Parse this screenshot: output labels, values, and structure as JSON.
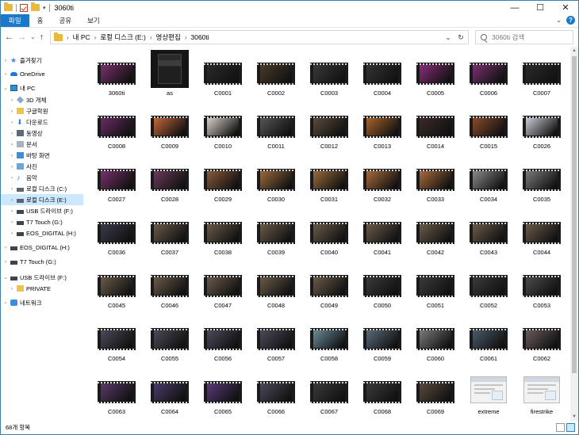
{
  "window": {
    "title": "3060ti",
    "controls": {
      "minimize": "—",
      "maximize": "☐",
      "close": "✕"
    }
  },
  "ribbon": {
    "tabs": [
      "파일",
      "홈",
      "공유",
      "보기"
    ],
    "help": "?"
  },
  "address": {
    "crumbs": [
      "내 PC",
      "로컬 디스크 (E:)",
      "영상편집",
      "3060ti"
    ],
    "search_placeholder": "3060ti 검색"
  },
  "nav": [
    {
      "label": "즐겨찾기",
      "icon": "quick-access-star-icon",
      "level": 0,
      "arrow": "›",
      "selected": false
    },
    {
      "label": "OneDrive",
      "icon": "onedrive-cloud-icon",
      "level": 0,
      "arrow": "›",
      "selected": false
    },
    {
      "label": "내 PC",
      "icon": "this-pc-icon",
      "level": 0,
      "arrow": "⌄",
      "selected": false
    },
    {
      "label": "3D 개체",
      "icon": "3d-objects-icon",
      "level": 1,
      "arrow": "›",
      "selected": false
    },
    {
      "label": "구글학원",
      "icon": "folder-icon",
      "level": 1,
      "arrow": "›",
      "selected": false
    },
    {
      "label": "다운로드",
      "icon": "downloads-icon",
      "level": 1,
      "arrow": "›",
      "selected": false
    },
    {
      "label": "동영상",
      "icon": "videos-icon",
      "level": 1,
      "arrow": "›",
      "selected": false
    },
    {
      "label": "문서",
      "icon": "documents-icon",
      "level": 1,
      "arrow": "›",
      "selected": false
    },
    {
      "label": "바탕 화면",
      "icon": "desktop-icon",
      "level": 1,
      "arrow": "›",
      "selected": false
    },
    {
      "label": "사진",
      "icon": "pictures-icon",
      "level": 1,
      "arrow": "›",
      "selected": false
    },
    {
      "label": "음악",
      "icon": "music-icon",
      "level": 1,
      "arrow": "›",
      "selected": false
    },
    {
      "label": "로컬 디스크 (C:)",
      "icon": "drive-icon",
      "level": 1,
      "arrow": "›",
      "selected": false
    },
    {
      "label": "로컬 디스크 (E:)",
      "icon": "drive-icon",
      "level": 1,
      "arrow": "›",
      "selected": true
    },
    {
      "label": "USB 드라이브 (F:)",
      "icon": "usb-drive-icon",
      "level": 1,
      "arrow": "›",
      "selected": false
    },
    {
      "label": "T7 Touch (G:)",
      "icon": "usb-drive-icon",
      "level": 1,
      "arrow": "›",
      "selected": false
    },
    {
      "label": "EOS_DIGITAL (H:)",
      "icon": "usb-drive-icon",
      "level": 1,
      "arrow": "›",
      "selected": false
    },
    {
      "label": "EOS_DIGITAL (H:)",
      "icon": "usb-drive-icon",
      "level": 0,
      "arrow": "›",
      "selected": false
    },
    {
      "label": "T7 Touch (G:)",
      "icon": "usb-drive-icon",
      "level": 0,
      "arrow": "›",
      "selected": false
    },
    {
      "label": "USB 드라이브 (F:)",
      "icon": "usb-drive-icon",
      "level": 0,
      "arrow": "⌄",
      "selected": false
    },
    {
      "label": "PRIVATE",
      "icon": "folder-icon",
      "level": 1,
      "arrow": "›",
      "selected": false
    },
    {
      "label": "네트워크",
      "icon": "network-icon",
      "level": 0,
      "arrow": "›",
      "selected": false
    }
  ],
  "files": [
    {
      "name": "3060ti",
      "kind": "folder-video",
      "tint": "#7a2f6e"
    },
    {
      "name": "as",
      "kind": "image",
      "tint": "#222222"
    },
    {
      "name": "C0001",
      "kind": "video",
      "tint": "#2b2b2b"
    },
    {
      "name": "C0002",
      "kind": "video",
      "tint": "#4a3a2a"
    },
    {
      "name": "C0003",
      "kind": "video",
      "tint": "#3a3a3a"
    },
    {
      "name": "C0004",
      "kind": "video",
      "tint": "#343434"
    },
    {
      "name": "C0005",
      "kind": "video",
      "tint": "#8a2d7a"
    },
    {
      "name": "C0006",
      "kind": "video",
      "tint": "#7a3070"
    },
    {
      "name": "C0007",
      "kind": "video",
      "tint": "#2a2a2a"
    },
    {
      "name": "C0008",
      "kind": "video",
      "tint": "#6a2b64"
    },
    {
      "name": "C0009",
      "kind": "video",
      "tint": "#c2673a"
    },
    {
      "name": "C0010",
      "kind": "video",
      "tint": "#d8d0c8"
    },
    {
      "name": "C0011",
      "kind": "video",
      "tint": "#555555"
    },
    {
      "name": "C0012",
      "kind": "video",
      "tint": "#5a4a3a"
    },
    {
      "name": "C0013",
      "kind": "video",
      "tint": "#a8642a"
    },
    {
      "name": "C0014",
      "kind": "video",
      "tint": "#3a2a28"
    },
    {
      "name": "C0015",
      "kind": "video",
      "tint": "#8a4a2a"
    },
    {
      "name": "C0026",
      "kind": "video",
      "tint": "#c8ccd6"
    },
    {
      "name": "C0027",
      "kind": "video",
      "tint": "#7a2f6e"
    },
    {
      "name": "C0028",
      "kind": "video",
      "tint": "#6a3a5a"
    },
    {
      "name": "C0029",
      "kind": "video",
      "tint": "#8a5a3a"
    },
    {
      "name": "C0030",
      "kind": "video",
      "tint": "#9a6a3a"
    },
    {
      "name": "C0031",
      "kind": "video",
      "tint": "#9a6a3a"
    },
    {
      "name": "C0032",
      "kind": "video",
      "tint": "#a86a3a"
    },
    {
      "name": "C0033",
      "kind": "video",
      "tint": "#a86a3a"
    },
    {
      "name": "C0034",
      "kind": "video",
      "tint": "#8a8a8a"
    },
    {
      "name": "C0035",
      "kind": "video",
      "tint": "#7a7a7a"
    },
    {
      "name": "C0036",
      "kind": "video",
      "tint": "#3a3a4a"
    },
    {
      "name": "C0037",
      "kind": "video",
      "tint": "#6a5a48"
    },
    {
      "name": "C0038",
      "kind": "video",
      "tint": "#6a5a48"
    },
    {
      "name": "C0039",
      "kind": "video",
      "tint": "#6a5a48"
    },
    {
      "name": "C0040",
      "kind": "video",
      "tint": "#6a5a48"
    },
    {
      "name": "C0041",
      "kind": "video",
      "tint": "#6a5a48"
    },
    {
      "name": "C0042",
      "kind": "video",
      "tint": "#6a5a48"
    },
    {
      "name": "C0043",
      "kind": "video",
      "tint": "#6a5a48"
    },
    {
      "name": "C0044",
      "kind": "video",
      "tint": "#6a5a48"
    },
    {
      "name": "C0045",
      "kind": "video",
      "tint": "#6a5a48"
    },
    {
      "name": "C0046",
      "kind": "video",
      "tint": "#6a5a48"
    },
    {
      "name": "C0047",
      "kind": "video",
      "tint": "#6a5a48"
    },
    {
      "name": "C0048",
      "kind": "video",
      "tint": "#6a5a48"
    },
    {
      "name": "C0049",
      "kind": "video",
      "tint": "#6a5a48"
    },
    {
      "name": "C0050",
      "kind": "video",
      "tint": "#3a3a3a"
    },
    {
      "name": "C0051",
      "kind": "video",
      "tint": "#3a3a3a"
    },
    {
      "name": "C0052",
      "kind": "video",
      "tint": "#3a3a3a"
    },
    {
      "name": "C0053",
      "kind": "video",
      "tint": "#4a4a4a"
    },
    {
      "name": "C0054",
      "kind": "video",
      "tint": "#4a4a5a"
    },
    {
      "name": "C0055",
      "kind": "video",
      "tint": "#4a4a5a"
    },
    {
      "name": "C0056",
      "kind": "video",
      "tint": "#4a4a5a"
    },
    {
      "name": "C0057",
      "kind": "video",
      "tint": "#4a4a5a"
    },
    {
      "name": "C0058",
      "kind": "video",
      "tint": "#6a8a9a"
    },
    {
      "name": "C0059",
      "kind": "video",
      "tint": "#5a6a7a"
    },
    {
      "name": "C0060",
      "kind": "video",
      "tint": "#7a7a7a"
    },
    {
      "name": "C0061",
      "kind": "video",
      "tint": "#4a5a6a"
    },
    {
      "name": "C0062",
      "kind": "video",
      "tint": "#6a5a5a"
    },
    {
      "name": "C0063",
      "kind": "video",
      "tint": "#5a3a6a"
    },
    {
      "name": "C0064",
      "kind": "video",
      "tint": "#4a3a6a"
    },
    {
      "name": "C0065",
      "kind": "video",
      "tint": "#5a3a7a"
    },
    {
      "name": "C0066",
      "kind": "video",
      "tint": "#4a4a5a"
    },
    {
      "name": "C0067",
      "kind": "video",
      "tint": "#3a3a3a"
    },
    {
      "name": "C0068",
      "kind": "video",
      "tint": "#3a3a3a"
    },
    {
      "name": "C0069",
      "kind": "video",
      "tint": "#5a4a3a"
    },
    {
      "name": "extreme",
      "kind": "document",
      "tint": "#f2f2f2"
    },
    {
      "name": "firestrike",
      "kind": "document",
      "tint": "#f2f2f2"
    }
  ],
  "status": {
    "item_count": "68개 항목"
  }
}
